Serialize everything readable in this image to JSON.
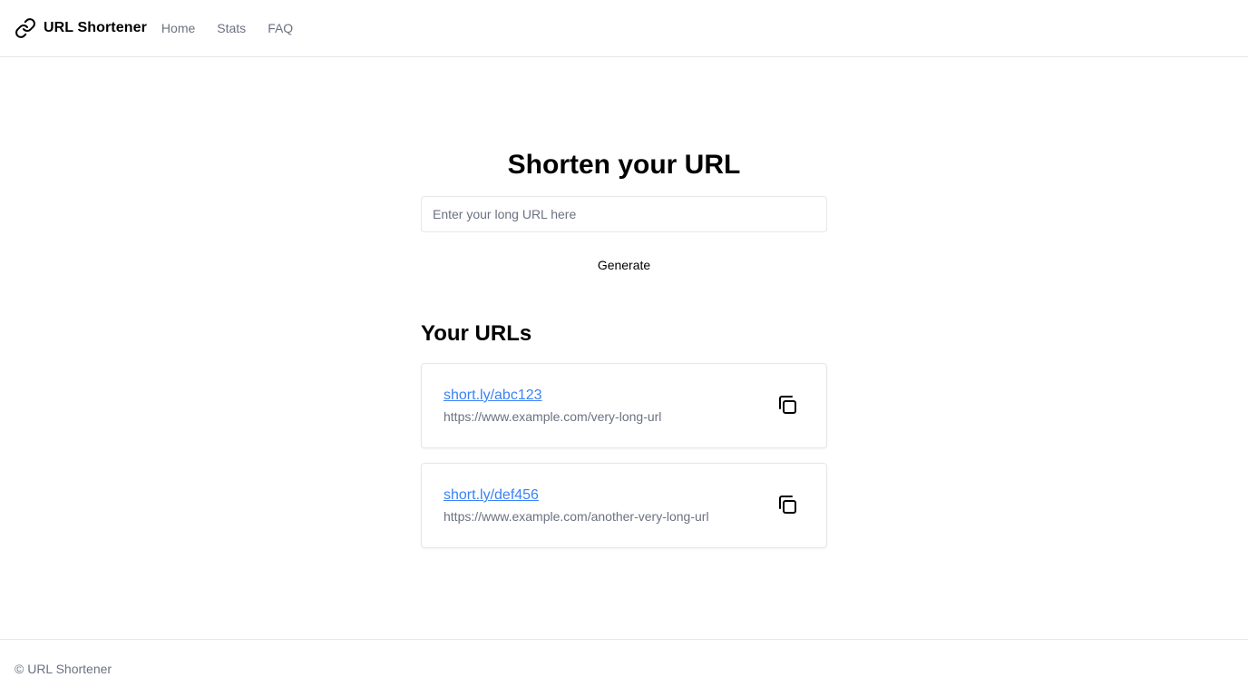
{
  "header": {
    "brand_name": "URL Shortener",
    "brand_icon": "link-icon",
    "nav": [
      {
        "label": "Home"
      },
      {
        "label": "Stats"
      },
      {
        "label": "FAQ"
      }
    ]
  },
  "main": {
    "title": "Shorten your URL",
    "input": {
      "value": "",
      "placeholder": "Enter your long URL here"
    },
    "generate_label": "Generate",
    "section_title": "Your URLs",
    "urls": [
      {
        "short": "short.ly/abc123",
        "long": "https://www.example.com/very-long-url",
        "copy_icon": "copy-icon"
      },
      {
        "short": "short.ly/def456",
        "long": "https://www.example.com/another-very-long-url",
        "copy_icon": "copy-icon"
      }
    ]
  },
  "footer": {
    "text": "© URL Shortener"
  },
  "colors": {
    "link": "#3b82f6",
    "muted_text": "#6b7280",
    "border": "#e5e7eb"
  }
}
